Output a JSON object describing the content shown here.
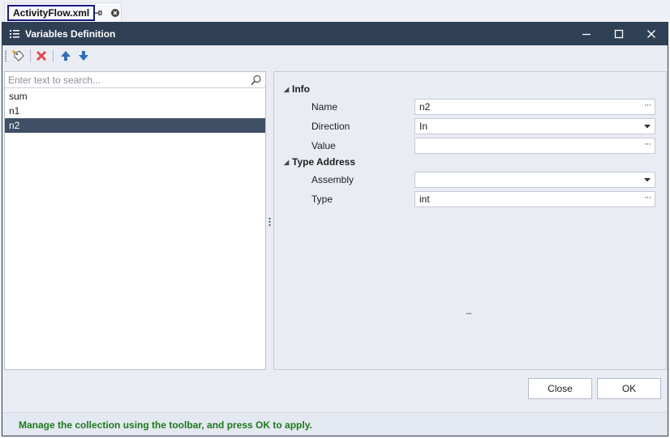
{
  "document_tab": {
    "title": "ActivityFlow.xml"
  },
  "dialog": {
    "title": "Variables Definition",
    "toolbar": {
      "add_tooltip_icon": "add-variable-icon",
      "delete_icon": "delete-icon",
      "move_up_icon": "move-up-icon",
      "move_down_icon": "move-down-icon"
    },
    "search": {
      "placeholder": "Enter text to search...",
      "value": ""
    },
    "variables": [
      {
        "name": "sum",
        "selected": false
      },
      {
        "name": "n1",
        "selected": false
      },
      {
        "name": "n2",
        "selected": true
      }
    ],
    "properties": {
      "groups": [
        {
          "name": "Info",
          "rows": [
            {
              "label": "Name",
              "value": "n2",
              "editor": "ellipsis"
            },
            {
              "label": "Direction",
              "value": "In",
              "editor": "dropdown"
            },
            {
              "label": "Value",
              "value": "",
              "editor": "ellipsis"
            }
          ]
        },
        {
          "name": "Type Address",
          "rows": [
            {
              "label": "Assembly",
              "value": "",
              "editor": "dropdown"
            },
            {
              "label": "Type",
              "value": "int",
              "editor": "ellipsis"
            }
          ]
        }
      ],
      "more_indicator": "..."
    },
    "buttons": {
      "close": "Close",
      "ok": "OK"
    },
    "status": "Manage the collection using the toolbar, and press OK to apply.",
    "colors": {
      "titlebar": "#2f3f54",
      "selection": "#3f4f66",
      "status_text": "#1a7a1a"
    }
  }
}
